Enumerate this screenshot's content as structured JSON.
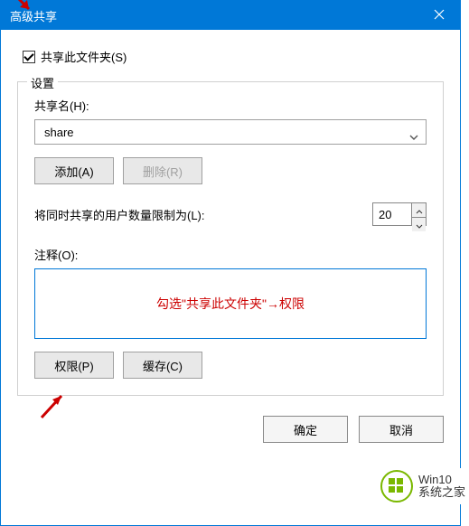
{
  "titlebar": {
    "title": "高级共享"
  },
  "share_checkbox": {
    "label": "共享此文件夹(S)",
    "checked": true
  },
  "settings": {
    "legend": "设置",
    "share_name_label": "共享名(H):",
    "share_name_value": "share",
    "add_label": "添加(A)",
    "delete_label": "删除(R)",
    "limit_label": "将同时共享的用户数量限制为(L):",
    "limit_value": "20",
    "comment_label": "注释(O):",
    "perm_label": "权限(P)",
    "cache_label": "缓存(C)"
  },
  "annotation": "勾选\"共享此文件夹\"→权限",
  "buttons": {
    "ok": "确定",
    "cancel": "取消"
  },
  "watermark": {
    "line1": "Win10",
    "line2": "系统之家"
  }
}
